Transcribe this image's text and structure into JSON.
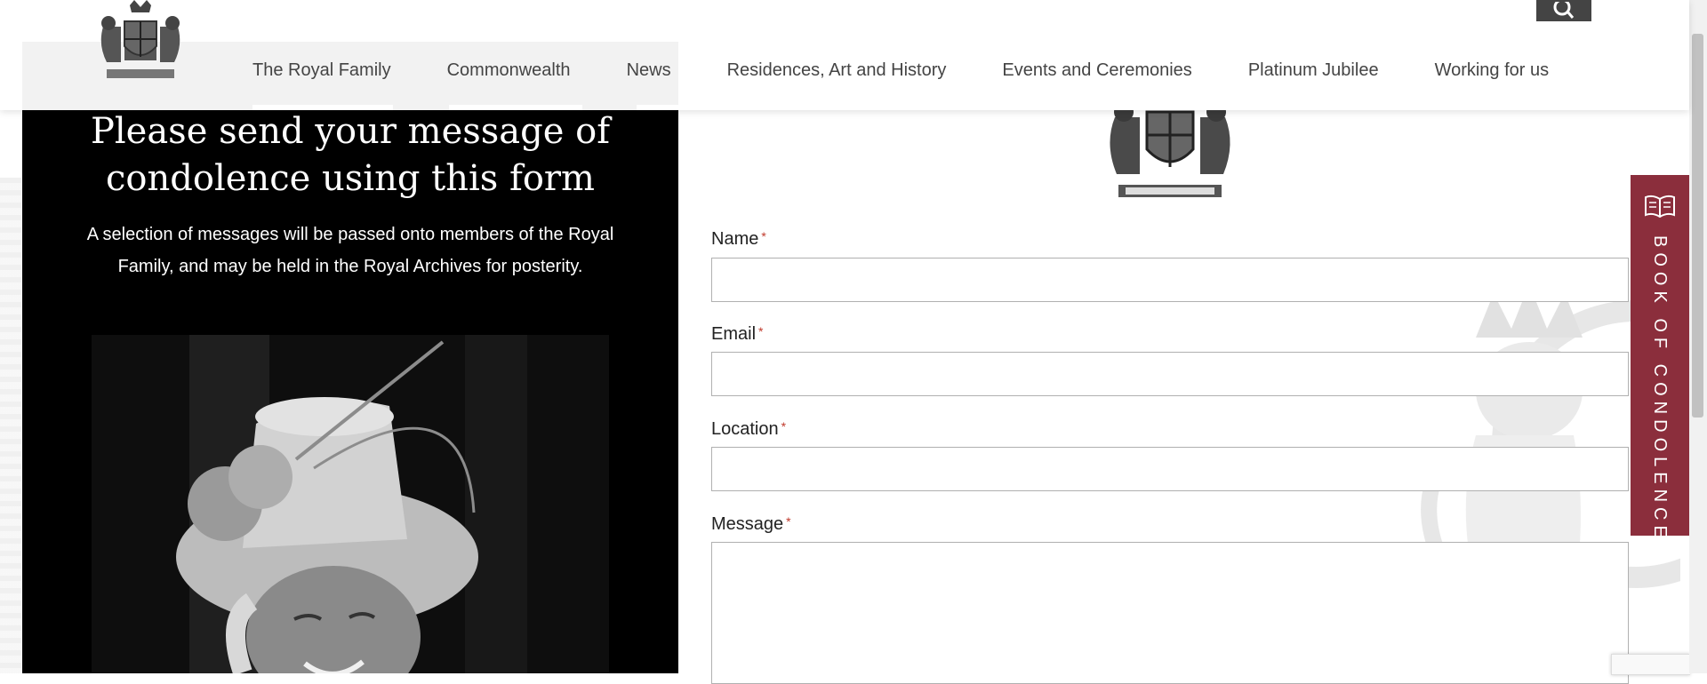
{
  "nav": {
    "items": [
      "The Royal Family",
      "Commonwealth",
      "News",
      "Residences, Art and History",
      "Events and Ceremonies",
      "Platinum Jubilee",
      "Working for us"
    ],
    "search_icon": "search-icon",
    "logo_icon": "royal-coat-of-arms"
  },
  "panel": {
    "title": "Please send your message of condolence using this form",
    "subtitle": "A selection of messages will be passed onto members of the Royal Family, and may be held in the Royal Archives for posterity.",
    "image_icon": "portrait-photo"
  },
  "form": {
    "crest_icon": "royal-coat-of-arms",
    "required_marker": "*",
    "fields": [
      {
        "label": "Name",
        "value": ""
      },
      {
        "label": "Email",
        "value": ""
      },
      {
        "label": "Location",
        "value": ""
      },
      {
        "label": "Message",
        "value": ""
      }
    ]
  },
  "condolence_tab": {
    "label": "BOOK OF CONDOLENCE",
    "icon": "open-book-icon"
  },
  "colors": {
    "panel_bg": "#000000",
    "tab_bg": "#8b2e3c",
    "required": "#c0392b",
    "search_bg": "#444444"
  }
}
